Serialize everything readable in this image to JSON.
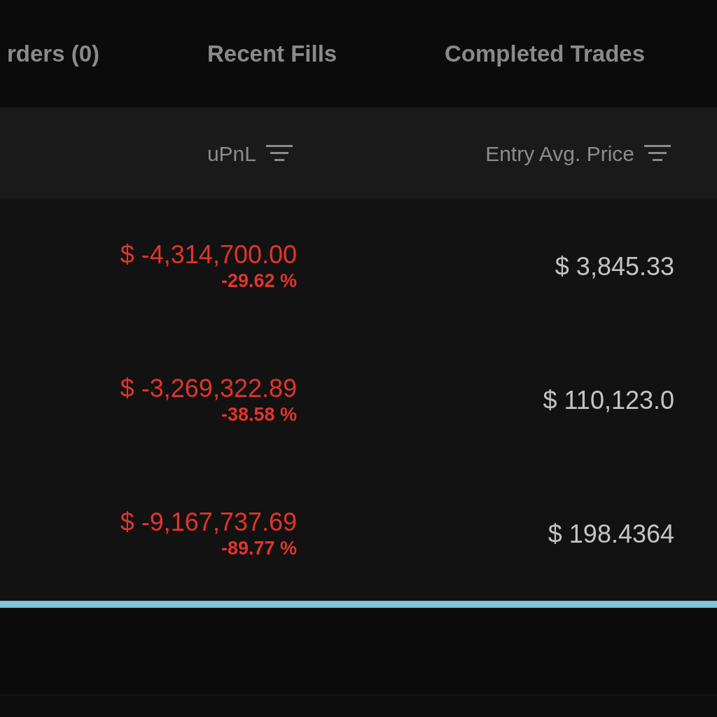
{
  "tabs": [
    {
      "label": "rders (0)"
    },
    {
      "label": "Recent Fills"
    },
    {
      "label": "Completed Trades"
    }
  ],
  "table": {
    "columns": [
      {
        "label": "uPnL"
      },
      {
        "label": "Entry Avg. Price"
      }
    ],
    "rows": [
      {
        "upnl": "$ -4,314,700.00",
        "upnl_percent": "-29.62 %",
        "entry_avg_price": "$ 3,845.33"
      },
      {
        "upnl": "$ -3,269,322.89",
        "upnl_percent": "-38.58 %",
        "entry_avg_price": "$ 110,123.0"
      },
      {
        "upnl": "$ -9,167,737.69",
        "upnl_percent": "-89.77 %",
        "entry_avg_price": "$ 198.4364"
      }
    ]
  }
}
